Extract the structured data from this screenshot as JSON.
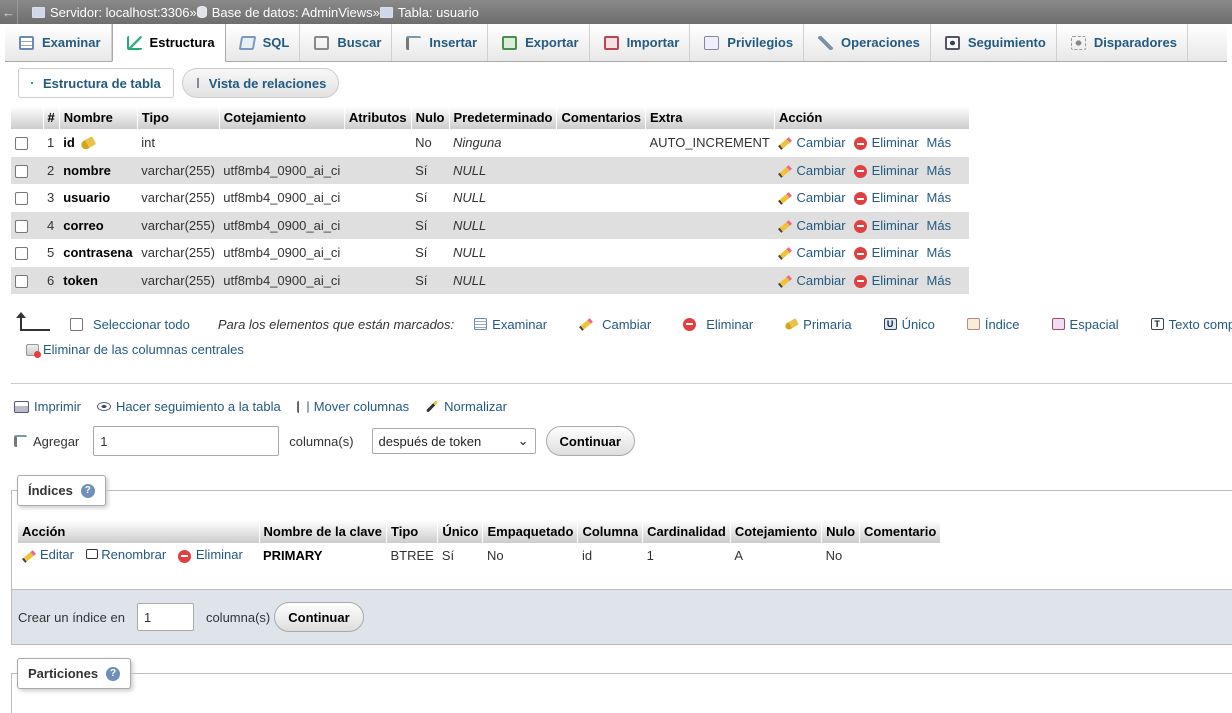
{
  "breadcrumb": {
    "server": "Servidor: localhost:3306",
    "database": "Base de datos: AdminViews",
    "table": "Tabla: usuario",
    "sep": "»"
  },
  "tabs": [
    {
      "label": "Examinar",
      "icon": "browse-icon"
    },
    {
      "label": "Estructura",
      "icon": "structure-icon",
      "active": true
    },
    {
      "label": "SQL",
      "icon": "sql-icon"
    },
    {
      "label": "Buscar",
      "icon": "search-icon"
    },
    {
      "label": "Insertar",
      "icon": "insert-icon"
    },
    {
      "label": "Exportar",
      "icon": "export-icon"
    },
    {
      "label": "Importar",
      "icon": "import-icon"
    },
    {
      "label": "Privilegios",
      "icon": "privileges-icon"
    },
    {
      "label": "Operaciones",
      "icon": "wrench-icon"
    },
    {
      "label": "Seguimiento",
      "icon": "eye-icon"
    },
    {
      "label": "Disparadores",
      "icon": "triggers-icon"
    }
  ],
  "subtabs": {
    "structure": "Estructura de tabla",
    "relations": "Vista de relaciones"
  },
  "columns_table": {
    "headers": [
      "#",
      "Nombre",
      "Tipo",
      "Cotejamiento",
      "Atributos",
      "Nulo",
      "Predeterminado",
      "Comentarios",
      "Extra",
      "Acción"
    ],
    "rows": [
      {
        "num": "1",
        "name": "id",
        "type": "int",
        "collation": "",
        "attributes": "",
        "null": "No",
        "default": "Ninguna",
        "comments": "",
        "extra": "AUTO_INCREMENT",
        "primary": true
      },
      {
        "num": "2",
        "name": "nombre",
        "type": "varchar(255)",
        "collation": "utf8mb4_0900_ai_ci",
        "attributes": "",
        "null": "Sí",
        "default": "NULL",
        "comments": "",
        "extra": ""
      },
      {
        "num": "3",
        "name": "usuario",
        "type": "varchar(255)",
        "collation": "utf8mb4_0900_ai_ci",
        "attributes": "",
        "null": "Sí",
        "default": "NULL",
        "comments": "",
        "extra": ""
      },
      {
        "num": "4",
        "name": "correo",
        "type": "varchar(255)",
        "collation": "utf8mb4_0900_ai_ci",
        "attributes": "",
        "null": "Sí",
        "default": "NULL",
        "comments": "",
        "extra": ""
      },
      {
        "num": "5",
        "name": "contrasena",
        "type": "varchar(255)",
        "collation": "utf8mb4_0900_ai_ci",
        "attributes": "",
        "null": "Sí",
        "default": "NULL",
        "comments": "",
        "extra": ""
      },
      {
        "num": "6",
        "name": "token",
        "type": "varchar(255)",
        "collation": "utf8mb4_0900_ai_ci",
        "attributes": "",
        "null": "Sí",
        "default": "NULL",
        "comments": "",
        "extra": ""
      }
    ],
    "actions": {
      "change": "Cambiar",
      "drop": "Eliminar",
      "more": "Más"
    }
  },
  "bulk": {
    "select_all": "Seleccionar todo",
    "for_marked": "Para los elementos que están marcados:",
    "items": [
      "Examinar",
      "Cambiar",
      "Eliminar",
      "Primaria",
      "Único",
      "Índice",
      "Espacial",
      "Texto completo"
    ],
    "central": "Eliminar de las columnas centrales"
  },
  "tools": {
    "print": "Imprimir",
    "track": "Hacer seguimiento a la tabla",
    "move": "Mover columnas",
    "normalize": "Normalizar"
  },
  "add_columns": {
    "label": "Agregar",
    "count": "1",
    "unit": "columna(s)",
    "position": "después de token",
    "submit": "Continuar"
  },
  "indexes": {
    "legend": "Índices",
    "headers": [
      "Acción",
      "Nombre de la clave",
      "Tipo",
      "Único",
      "Empaquetado",
      "Columna",
      "Cardinalidad",
      "Cotejamiento",
      "Nulo",
      "Comentario"
    ],
    "row": {
      "edit": "Editar",
      "rename": "Renombrar",
      "drop": "Eliminar",
      "key": "PRIMARY",
      "type": "BTREE",
      "unique": "Sí",
      "packed": "No",
      "column": "id",
      "cardinality": "1",
      "collation": "A",
      "null": "No",
      "comment": ""
    },
    "create_label": "Crear un índice en",
    "create_count": "1",
    "create_unit": "columna(s)",
    "create_submit": "Continuar"
  },
  "partitions": {
    "legend": "Particiones"
  },
  "help_glyph": "?"
}
